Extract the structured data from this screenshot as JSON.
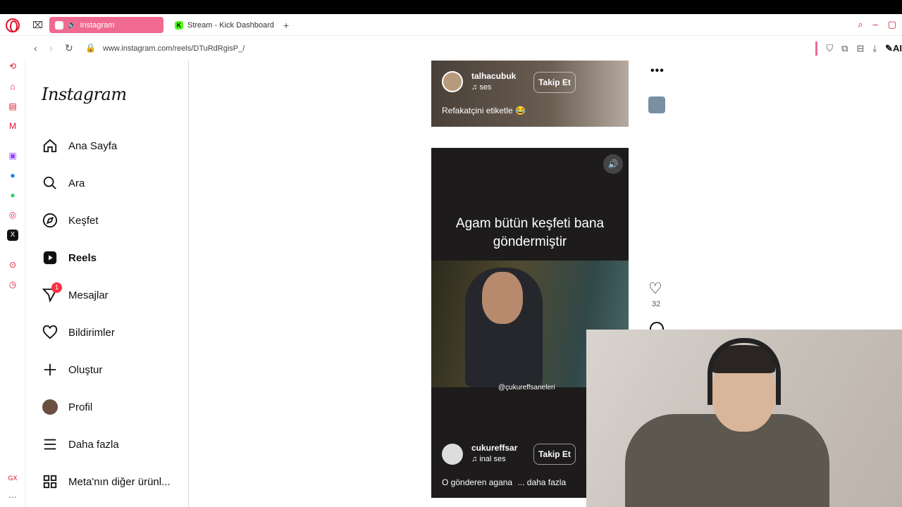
{
  "browser": {
    "tabs": [
      {
        "label": "Instagram",
        "active": true
      },
      {
        "label": "Stream - Kick Dashboard",
        "active": false
      }
    ],
    "url": "www.instagram.com/reels/DTuRdRgisP_/",
    "colors": {
      "accent": "#e0112b",
      "active_tab": "#f06a8f"
    },
    "sidebar_icons": [
      "history-icon",
      "speed-dial-icon",
      "workspace-icon",
      "mail-icon",
      "twitch-icon",
      "messenger-icon",
      "whatsapp-icon",
      "instagram-icon",
      "x-icon",
      "player-icon",
      "clock-icon"
    ]
  },
  "instagram": {
    "logo": "Instagram",
    "nav": [
      {
        "label": "Ana Sayfa",
        "icon": "home-icon"
      },
      {
        "label": "Ara",
        "icon": "search-icon"
      },
      {
        "label": "Keşfet",
        "icon": "compass-icon"
      },
      {
        "label": "Reels",
        "icon": "reels-icon"
      },
      {
        "label": "Mesajlar",
        "icon": "messages-icon",
        "badge": "1"
      },
      {
        "label": "Bildirimler",
        "icon": "heart-icon"
      },
      {
        "label": "Oluştur",
        "icon": "plus-icon"
      },
      {
        "label": "Profil",
        "icon": "avatar-icon"
      },
      {
        "label": "Daha fazla",
        "icon": "menu-icon"
      },
      {
        "label": "Meta'nın diğer ürünl...",
        "icon": "meta-apps-icon"
      }
    ]
  },
  "reel_top": {
    "username": "talhacubuk",
    "sound": "ses",
    "follow": "Takip Et",
    "caption": "Refakatçini etiketle 😂"
  },
  "reel_main": {
    "overlay_line1": "Agam bütün keşfeti bana",
    "overlay_line2": "göndermiştir",
    "watermark": "@çukureffsaneleri",
    "username": "cukureffsar",
    "sound": "inal ses",
    "follow": "Takip Et",
    "caption": "O gönderen agana",
    "more": "... daha fazla"
  },
  "actions": {
    "more": "•••",
    "likes": "32"
  }
}
